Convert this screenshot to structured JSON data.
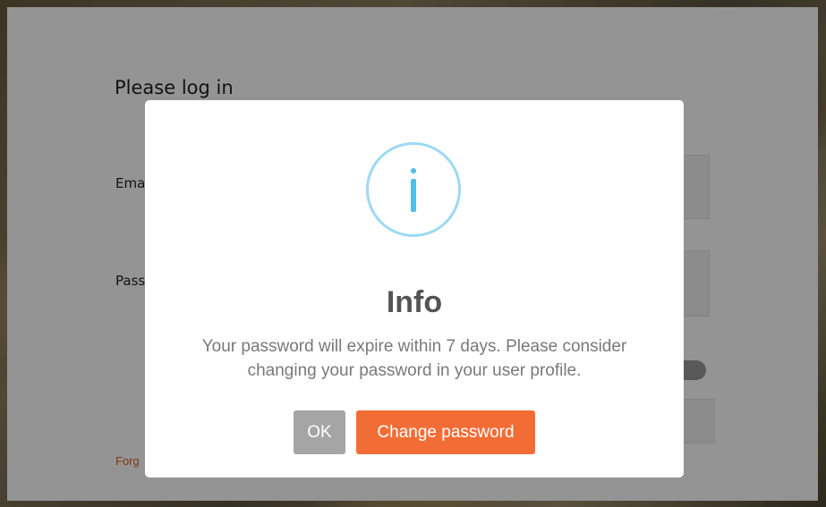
{
  "login": {
    "title": "Please log in",
    "email_label": "Ema",
    "password_label": "Pass",
    "forgot_link": "Forg"
  },
  "modal": {
    "icon": "info-icon",
    "title": "Info",
    "message": "Your password will expire within 7 days. Please consider changing your password in your user profile.",
    "ok_label": "OK",
    "change_label": "Change password"
  },
  "colors": {
    "info_icon_ring": "#9dd9f3",
    "info_icon_glyph": "#52bde8",
    "ok_button": "#a5a5a5",
    "change_button": "#f26d36",
    "forgot_link": "#e0622a"
  }
}
